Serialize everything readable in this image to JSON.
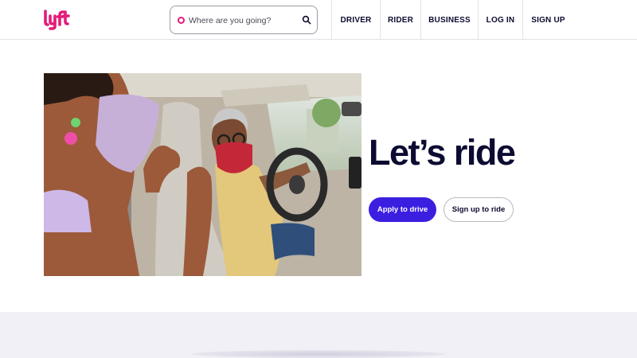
{
  "brand": {
    "logo_text": "lyft",
    "accent": "#e31c79",
    "primary": "#3b1fe0",
    "ink": "#0c0b31"
  },
  "search": {
    "placeholder": "Where are you going?",
    "value": ""
  },
  "nav": [
    {
      "label": "DRIVER"
    },
    {
      "label": "RIDER"
    },
    {
      "label": "BUSINESS"
    },
    {
      "label": "LOG IN"
    },
    {
      "label": "SIGN UP"
    }
  ],
  "hero": {
    "headline": "Let’s ride",
    "primary_cta": "Apply to drive",
    "secondary_cta": "Sign up to ride",
    "image": "rider and masked driver in car"
  }
}
